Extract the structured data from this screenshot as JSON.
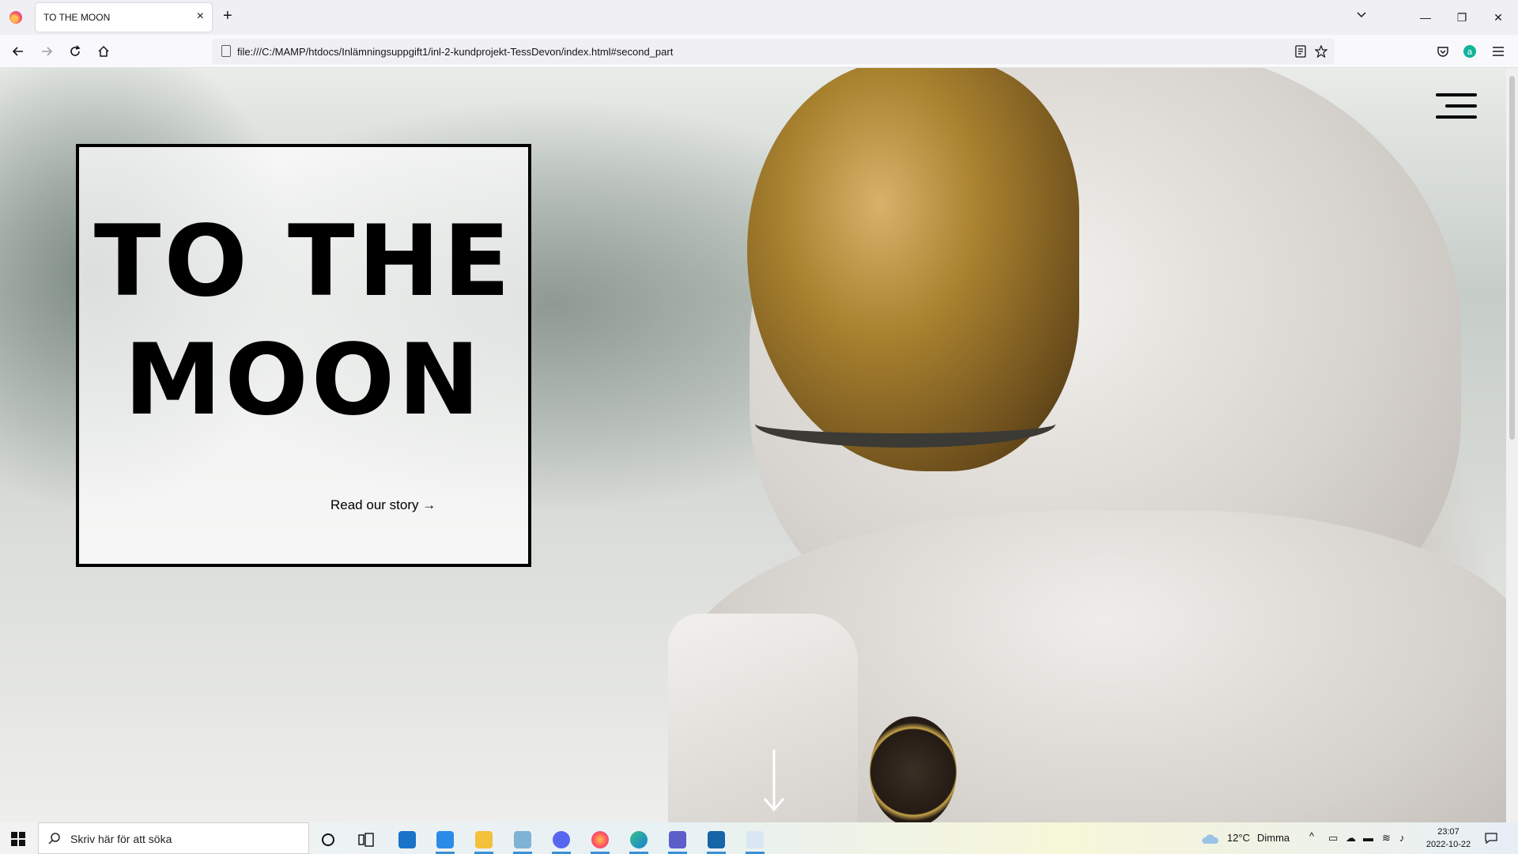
{
  "browser": {
    "tab_title": "TO THE MOON",
    "url": "file:///C:/MAMP/htdocs/Inlämningsuppgift1/inl-2-kundprojekt-TessDevon/index.html#second_part",
    "tab_close": "×",
    "new_tab": "+",
    "win_min": "—",
    "win_max": "❐",
    "win_close": "✕"
  },
  "hero": {
    "title": "TO THE MOON",
    "cta": "Read our story →"
  },
  "taskbar": {
    "search_placeholder": "Skriv här för att söka",
    "weather_temp": "12°C",
    "weather_text": "Dimma",
    "time": "23:07",
    "date": "2022-10-22",
    "apps": [
      "cortana",
      "task-view",
      "mail",
      "vscode",
      "file-explorer",
      "app-folder",
      "discord",
      "firefox",
      "edge",
      "teams",
      "photos",
      "paint"
    ]
  },
  "colors": {
    "accent": "#3a8fd6",
    "hero_border": "#000000"
  }
}
